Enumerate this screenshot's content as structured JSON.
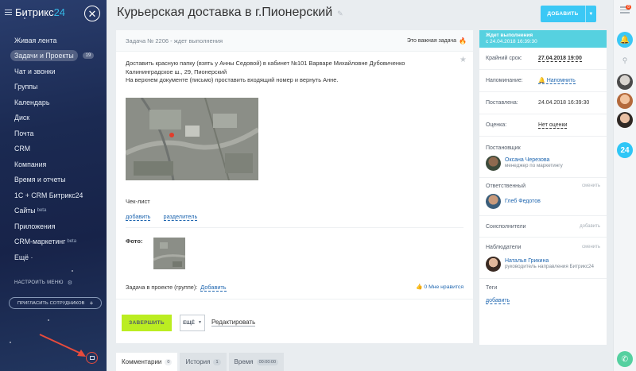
{
  "sidebar": {
    "logo_text": "Битрикс",
    "logo_num": "24",
    "items": [
      {
        "label": "Живая лента"
      },
      {
        "label": "Задачи и Проекты",
        "badge": "19"
      },
      {
        "label": "Чат и звонки"
      },
      {
        "label": "Группы"
      },
      {
        "label": "Календарь"
      },
      {
        "label": "Диск"
      },
      {
        "label": "Почта"
      },
      {
        "label": "CRM"
      },
      {
        "label": "Компания"
      },
      {
        "label": "Время и отчеты"
      },
      {
        "label": "1С + CRM Битрикс24"
      },
      {
        "label": "Сайты",
        "sup": "beta"
      },
      {
        "label": "Приложения"
      },
      {
        "label": "CRM-маркетинг",
        "sup": "beta"
      },
      {
        "label": "Ещё ·"
      }
    ],
    "settings_label": "НАСТРОИТЬ МЕНЮ",
    "invite_label": "ПРИГЛАСИТЬ СОТРУДНИКОВ"
  },
  "header": {
    "title": "Курьерская доставка в г.Пионерский",
    "add_label": "ДОБАВИТЬ"
  },
  "task": {
    "number": "Задача № 2206 - ждет выполнения",
    "important": "Это важная задача",
    "description": [
      "Доставить красную папку (взять у Анны Седовой) в кабинет №101 Варваре Михайловне Дубовиченко",
      "Калининградское ш., 29, Пионерский",
      "На верхнем документе (письмо) проставить входящий номер и вернуть Анне."
    ],
    "checklist_label": "Чек-лист",
    "checklist_add": "добавить",
    "checklist_sep": "разделитель",
    "photo_label": "Фото:",
    "project_label": "Задача в проекте (группе):",
    "project_add": "Добавить",
    "like_label": "0 Мне нравится",
    "finish_label": "ЗАВЕРШИТЬ",
    "more_label": "ЕЩЁ",
    "edit_label": "Редактировать"
  },
  "tabs": [
    {
      "label": "Комментарии",
      "count": "0"
    },
    {
      "label": "История",
      "count": "1"
    },
    {
      "label": "Время",
      "count": "00:00:00"
    }
  ],
  "panel": {
    "status": "Ждет выполнения",
    "status_since": "с 24.04.2018 16:39:30",
    "deadline_k": "Крайний срок:",
    "deadline_v": "27.04.2018 19:00",
    "remind_k": "Напоминание:",
    "remind_v": "Напомнить",
    "created_k": "Поставлена:",
    "created_v": "24.04.2018 16:39:30",
    "rating_k": "Оценка:",
    "rating_v": "Нет оценки",
    "creator_hd": "Постановщик",
    "creator_name": "Оксана Черезова",
    "creator_role": "менеджер по маркетингу",
    "resp_hd": "Ответственный",
    "resp_act": "сменить",
    "resp_name": "Глеб Федотов",
    "coexec_hd": "Соисполнители",
    "coexec_act": "добавить",
    "observers_hd": "Наблюдатели",
    "observers_act": "сменить",
    "observer_name": "Наталья Грикина",
    "observer_role": "руководитель направления Битрикс24",
    "tags_hd": "Теги",
    "tags_add": "добавить"
  },
  "rbar": {
    "notif_count": "8"
  },
  "colors": {
    "accent": "#3bc8f5",
    "finish": "#bbed21",
    "status": "#56d1e0",
    "link": "#2067b0"
  }
}
